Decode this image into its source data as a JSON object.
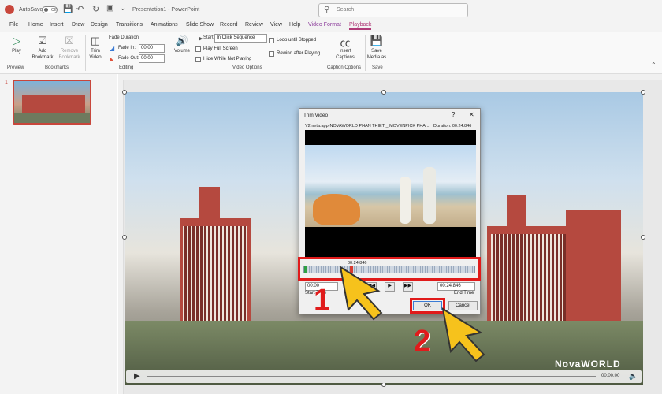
{
  "titlebar": {
    "autosave_label": "AutoSave",
    "autosave_state": "Off",
    "document_title": "Presentation1  -  PowerPoint",
    "search_placeholder": "Search"
  },
  "menu_tabs": [
    "File",
    "Home",
    "Insert",
    "Draw",
    "Design",
    "Transitions",
    "Animations",
    "Slide Show",
    "Record",
    "Review",
    "View",
    "Help",
    "Video Format",
    "Playback"
  ],
  "ribbon": {
    "play": "Play",
    "add_bookmark": [
      "Add",
      "Bookmark"
    ],
    "remove_bookmark": [
      "Remove",
      "Bookmark"
    ],
    "trim_video": [
      "Trim",
      "Video"
    ],
    "fade_duration": "Fade Duration",
    "fade_in_label": "Fade In:",
    "fade_in_value": "00.00",
    "fade_out_label": "Fade Out:",
    "fade_out_value": "00.00",
    "volume": "Volume",
    "start_label": "Start:",
    "start_value": "In Click Sequence",
    "play_full_screen": "Play Full Screen",
    "hide_while_not_playing": "Hide While Not Playing",
    "loop_until_stopped": "Loop until Stopped",
    "rewind_after_playing": "Rewind after Playing",
    "insert_captions": [
      "Insert",
      "Captions"
    ],
    "save_media_as": [
      "Save",
      "Media as"
    ],
    "groups": {
      "preview": "Preview",
      "bookmarks": "Bookmarks",
      "editing": "Editing",
      "video_options": "Video Options",
      "caption_options": "Caption Options",
      "save": "Save"
    }
  },
  "slide_number": "1",
  "slide_watermark": "NovaWORLD",
  "playbar": {
    "time": "00:00.00"
  },
  "dialog": {
    "title": "Trim Video",
    "help": "?",
    "close": "✕",
    "file_name": "Y2meta.app-NOVAWORLD PHAN THIET _ MOVENPICK PHA...",
    "duration": "Duration: 00:24.846",
    "marker_time": "00:24.846",
    "start_time_value": "00:00",
    "end_time_value": "00:24.846",
    "start_time_label": "Start Time",
    "end_time_label": "End Time",
    "ok": "OK",
    "cancel": "Cancel"
  },
  "annotations": {
    "step1": "1",
    "step2": "2"
  },
  "colors": {
    "accent": "#b03a78",
    "highlight": "#e01b1b",
    "arrow": "#f6c21c"
  }
}
